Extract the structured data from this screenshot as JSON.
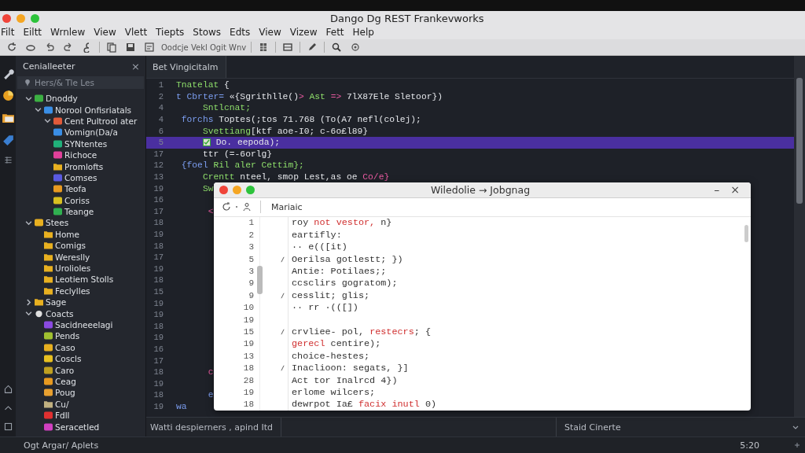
{
  "window": {
    "title": "Dango Dg REST Frankevworks"
  },
  "menu": [
    "Filt",
    "Eiltt",
    "Wrnlew",
    "View",
    "Vlett",
    "Tiepts",
    "Stows",
    "Edts",
    "View",
    "Vizew",
    "Fett",
    "Help"
  ],
  "toolbar": {
    "label": "Oodcje Vekl Ogit Wnv"
  },
  "sidebar": {
    "title": "Cenialleeter",
    "close": "×",
    "search": {
      "placeholder": "Hers/& Tle Les"
    },
    "tree": [
      {
        "label": "Dnoddy",
        "kind": "app",
        "color": "#3cb043",
        "expanded": true,
        "children": [
          {
            "label": "Norool Onfisriatals",
            "kind": "app",
            "color": "#3a8ee6",
            "expanded": true,
            "children": [
              {
                "label": "Cent Pultrool ater",
                "kind": "app",
                "color": "#e05a3a",
                "expanded": true
              },
              {
                "label": "Vomign(Da/a",
                "kind": "app",
                "color": "#3a8ee6"
              },
              {
                "label": "SYNtentes",
                "kind": "app",
                "color": "#20b07a"
              },
              {
                "label": "Richoce",
                "kind": "app",
                "color": "#e0409a"
              },
              {
                "label": "Promlofts",
                "kind": "folder",
                "color": "#e8b020"
              },
              {
                "label": "Comses",
                "kind": "app",
                "color": "#5a5ae0"
              },
              {
                "label": "Teofa",
                "kind": "app",
                "color": "#e89a20"
              },
              {
                "label": "Coriss",
                "kind": "app",
                "color": "#d8c020"
              },
              {
                "label": "Teange",
                "kind": "app",
                "color": "#30b050"
              }
            ]
          }
        ]
      },
      {
        "label": "Stees",
        "kind": "app",
        "color": "#e8b020",
        "expanded": true,
        "children": [
          {
            "label": "Home",
            "kind": "folder",
            "color": "#e8b020"
          },
          {
            "label": "Comigs",
            "kind": "folder",
            "color": "#e8b020"
          },
          {
            "label": "Wereslly",
            "kind": "folder",
            "color": "#e8b020"
          },
          {
            "label": "Urolioles",
            "kind": "folder",
            "color": "#e8b020"
          },
          {
            "label": "Leotiem Stolls",
            "kind": "folder",
            "color": "#e8b020"
          },
          {
            "label": "Feclylles",
            "kind": "folder",
            "color": "#e8b020"
          }
        ]
      },
      {
        "label": "Sage",
        "kind": "folder",
        "color": "#e8b020",
        "expanded": false
      },
      {
        "label": "Coacts",
        "kind": "dot",
        "color": "#e0e0e0",
        "expanded": true,
        "children": [
          {
            "label": "Sacidneeelagi",
            "kind": "app",
            "color": "#8a4ae0"
          },
          {
            "label": "Pends",
            "kind": "app",
            "color": "#a0c030"
          },
          {
            "label": "Caso",
            "kind": "app",
            "color": "#e8b020"
          },
          {
            "label": "Coscls",
            "kind": "app",
            "color": "#e8c020"
          },
          {
            "label": "Caro",
            "kind": "app",
            "color": "#c0a020"
          },
          {
            "label": "Ceag",
            "kind": "app",
            "color": "#e89a20"
          },
          {
            "label": "Poug",
            "kind": "app",
            "color": "#e8a030"
          },
          {
            "label": "Cu/",
            "kind": "folder",
            "color": "#c0b080"
          },
          {
            "label": "Fdll",
            "kind": "app",
            "color": "#e03030"
          },
          {
            "label": "Seracetled",
            "kind": "app",
            "color": "#d040c0"
          }
        ]
      }
    ],
    "footer": "Ogt Argar/ Aplets"
  },
  "editor": {
    "tab": "Bet Vingicitalm",
    "lines": [
      {
        "num": "1",
        "highlighted": false,
        "segments": [
          {
            "text": "Tnatelat ",
            "kind": "str"
          },
          {
            "text": "{",
            "kind": "plain"
          }
        ]
      },
      {
        "num": "2",
        "highlighted": false,
        "segments": [
          {
            "text": "t Cbrter= ",
            "kind": "kw"
          },
          {
            "text": "«{Sgrithlle()",
            "kind": "plain"
          },
          {
            "text": "> ",
            "kind": "err"
          },
          {
            "text": "Ast ",
            "kind": "str"
          },
          {
            "text": "=> ",
            "kind": "err"
          },
          {
            "text": "7lX87Ele ",
            "kind": "plain"
          },
          {
            "text": "Sletoor})",
            "kind": "plain"
          }
        ]
      },
      {
        "num": "4",
        "highlighted": false,
        "segments": [
          {
            "text": "     Sntlcnat;",
            "kind": "str"
          }
        ]
      },
      {
        "num": "4",
        "highlighted": false,
        "segments": [
          {
            "text": " forchs ",
            "kind": "kw"
          },
          {
            "text": "Toptes(;tos 71.768 (To(A7 nefl(colej);",
            "kind": "plain"
          }
        ]
      },
      {
        "num": "6",
        "highlighted": false,
        "segments": [
          {
            "text": "     Svettiang",
            "kind": "str"
          },
          {
            "text": "[ktf aoe-I0; c-6o£l89}",
            "kind": "plain"
          }
        ]
      },
      {
        "num": "5",
        "highlighted": true,
        "segments": [
          {
            "kind": "icon"
          },
          {
            "text": " Do. eepoda);",
            "kind": "plain"
          }
        ]
      },
      {
        "num": "17",
        "highlighted": false,
        "segments": [
          {
            "text": "     ttr (=-6orlg}",
            "kind": "plain"
          }
        ]
      },
      {
        "num": "12",
        "highlighted": false,
        "segments": [
          {
            "text": " {foel ",
            "kind": "kw"
          },
          {
            "text": "Ril aler Cettim};",
            "kind": "str"
          }
        ]
      },
      {
        "num": "13",
        "highlighted": false,
        "segments": [
          {
            "text": "     Crentt ",
            "kind": "str"
          },
          {
            "text": "nteel, smop Lest,as oe ",
            "kind": "plain"
          },
          {
            "text": "Co/e}",
            "kind": "err"
          }
        ]
      },
      {
        "num": "19",
        "highlighted": false,
        "segments": [
          {
            "text": "     Sw",
            "kind": "str"
          }
        ]
      },
      {
        "num": "16",
        "highlighted": false
      },
      {
        "num": "17",
        "highlighted": false,
        "segments": [
          {
            "text": "      <",
            "kind": "err"
          }
        ]
      },
      {
        "num": "18",
        "highlighted": false
      },
      {
        "num": "19",
        "highlighted": false
      },
      {
        "num": "18",
        "highlighted": false
      },
      {
        "num": "17",
        "highlighted": false
      },
      {
        "num": "19",
        "highlighted": false
      },
      {
        "num": "18",
        "highlighted": false
      },
      {
        "num": "15",
        "highlighted": false
      },
      {
        "num": "19",
        "highlighted": false
      },
      {
        "num": "19",
        "highlighted": false
      },
      {
        "num": "18",
        "highlighted": false
      },
      {
        "num": "19",
        "highlighted": false
      },
      {
        "num": "16",
        "highlighted": false
      },
      {
        "num": "17",
        "highlighted": false
      },
      {
        "num": "18",
        "highlighted": false,
        "segments": [
          {
            "text": "      c",
            "kind": "err"
          }
        ]
      },
      {
        "num": "19",
        "highlighted": false
      },
      {
        "num": "18",
        "highlighted": false,
        "segments": [
          {
            "text": "      e",
            "kind": "kw"
          }
        ]
      },
      {
        "num": "19",
        "highlighted": false,
        "segments": [
          {
            "text": "wa",
            "kind": "kw"
          }
        ]
      }
    ]
  },
  "dialog": {
    "title": "Wiledolie → Jobgnag",
    "minimize": "–",
    "close": "×",
    "toolbar_label": "Mariaic",
    "lines": [
      {
        "num": "1",
        "marked": false,
        "segments": [
          {
            "text": "roy ",
            "kind": "plain"
          },
          {
            "text": "not vestor, ",
            "kind": "err"
          },
          {
            "text": "n}",
            "kind": "plain"
          }
        ]
      },
      {
        "num": "2",
        "marked": false,
        "segments": [
          {
            "text": "eartifly:",
            "kind": "plain"
          }
        ]
      },
      {
        "num": "3",
        "marked": false,
        "segments": [
          {
            "text": "·· e(([it)",
            "kind": "plain"
          }
        ]
      },
      {
        "num": "5",
        "marked": true,
        "segments": [
          {
            "text": "Oerilsa gotlestt; })",
            "kind": "plain"
          }
        ]
      },
      {
        "num": "3",
        "marked": false,
        "segments": [
          {
            "text": "Antie: Potilaes;;",
            "kind": "plain"
          }
        ]
      },
      {
        "num": "9",
        "marked": false,
        "segments": [
          {
            "text": "ccsclirs gogratom);",
            "kind": "plain"
          }
        ]
      },
      {
        "num": "9",
        "marked": true,
        "segments": [
          {
            "text": "cesslit; glis;",
            "kind": "plain"
          }
        ]
      },
      {
        "num": "10",
        "marked": false,
        "segments": [
          {
            "text": "·· rr ·(([])",
            "kind": "plain"
          }
        ]
      },
      {
        "num": "19",
        "marked": false
      },
      {
        "num": "15",
        "marked": true,
        "segments": [
          {
            "text": "crvliee- pol, ",
            "kind": "plain"
          },
          {
            "text": "restecrs",
            "kind": "err"
          },
          {
            "text": "; {",
            "kind": "plain"
          }
        ]
      },
      {
        "num": "19",
        "marked": false,
        "segments": [
          {
            "text": "gerecl",
            "kind": "err"
          },
          {
            "text": " centire);",
            "kind": "plain"
          }
        ]
      },
      {
        "num": "13",
        "marked": false,
        "segments": [
          {
            "text": "choice-hestes;",
            "kind": "plain"
          }
        ]
      },
      {
        "num": "18",
        "marked": true,
        "segments": [
          {
            "text": "Inaclioon: segats, }]",
            "kind": "plain"
          }
        ]
      },
      {
        "num": "28",
        "marked": false,
        "segments": [
          {
            "text": "Act tor Inalrcd 4})",
            "kind": "plain"
          }
        ]
      },
      {
        "num": "19",
        "marked": false,
        "segments": [
          {
            "text": "erlome wilcers;",
            "kind": "plain"
          }
        ]
      },
      {
        "num": "18",
        "marked": false,
        "segments": [
          {
            "text": "dewrpot Ia£ ",
            "kind": "plain"
          },
          {
            "text": "facix inutl",
            "kind": "err"
          },
          {
            "text": " 0)",
            "kind": "plain"
          }
        ]
      }
    ]
  },
  "status_bar": {
    "left": "Watti despierners , apind Itd",
    "right": "Staid Cinerte",
    "position": "5:20"
  }
}
